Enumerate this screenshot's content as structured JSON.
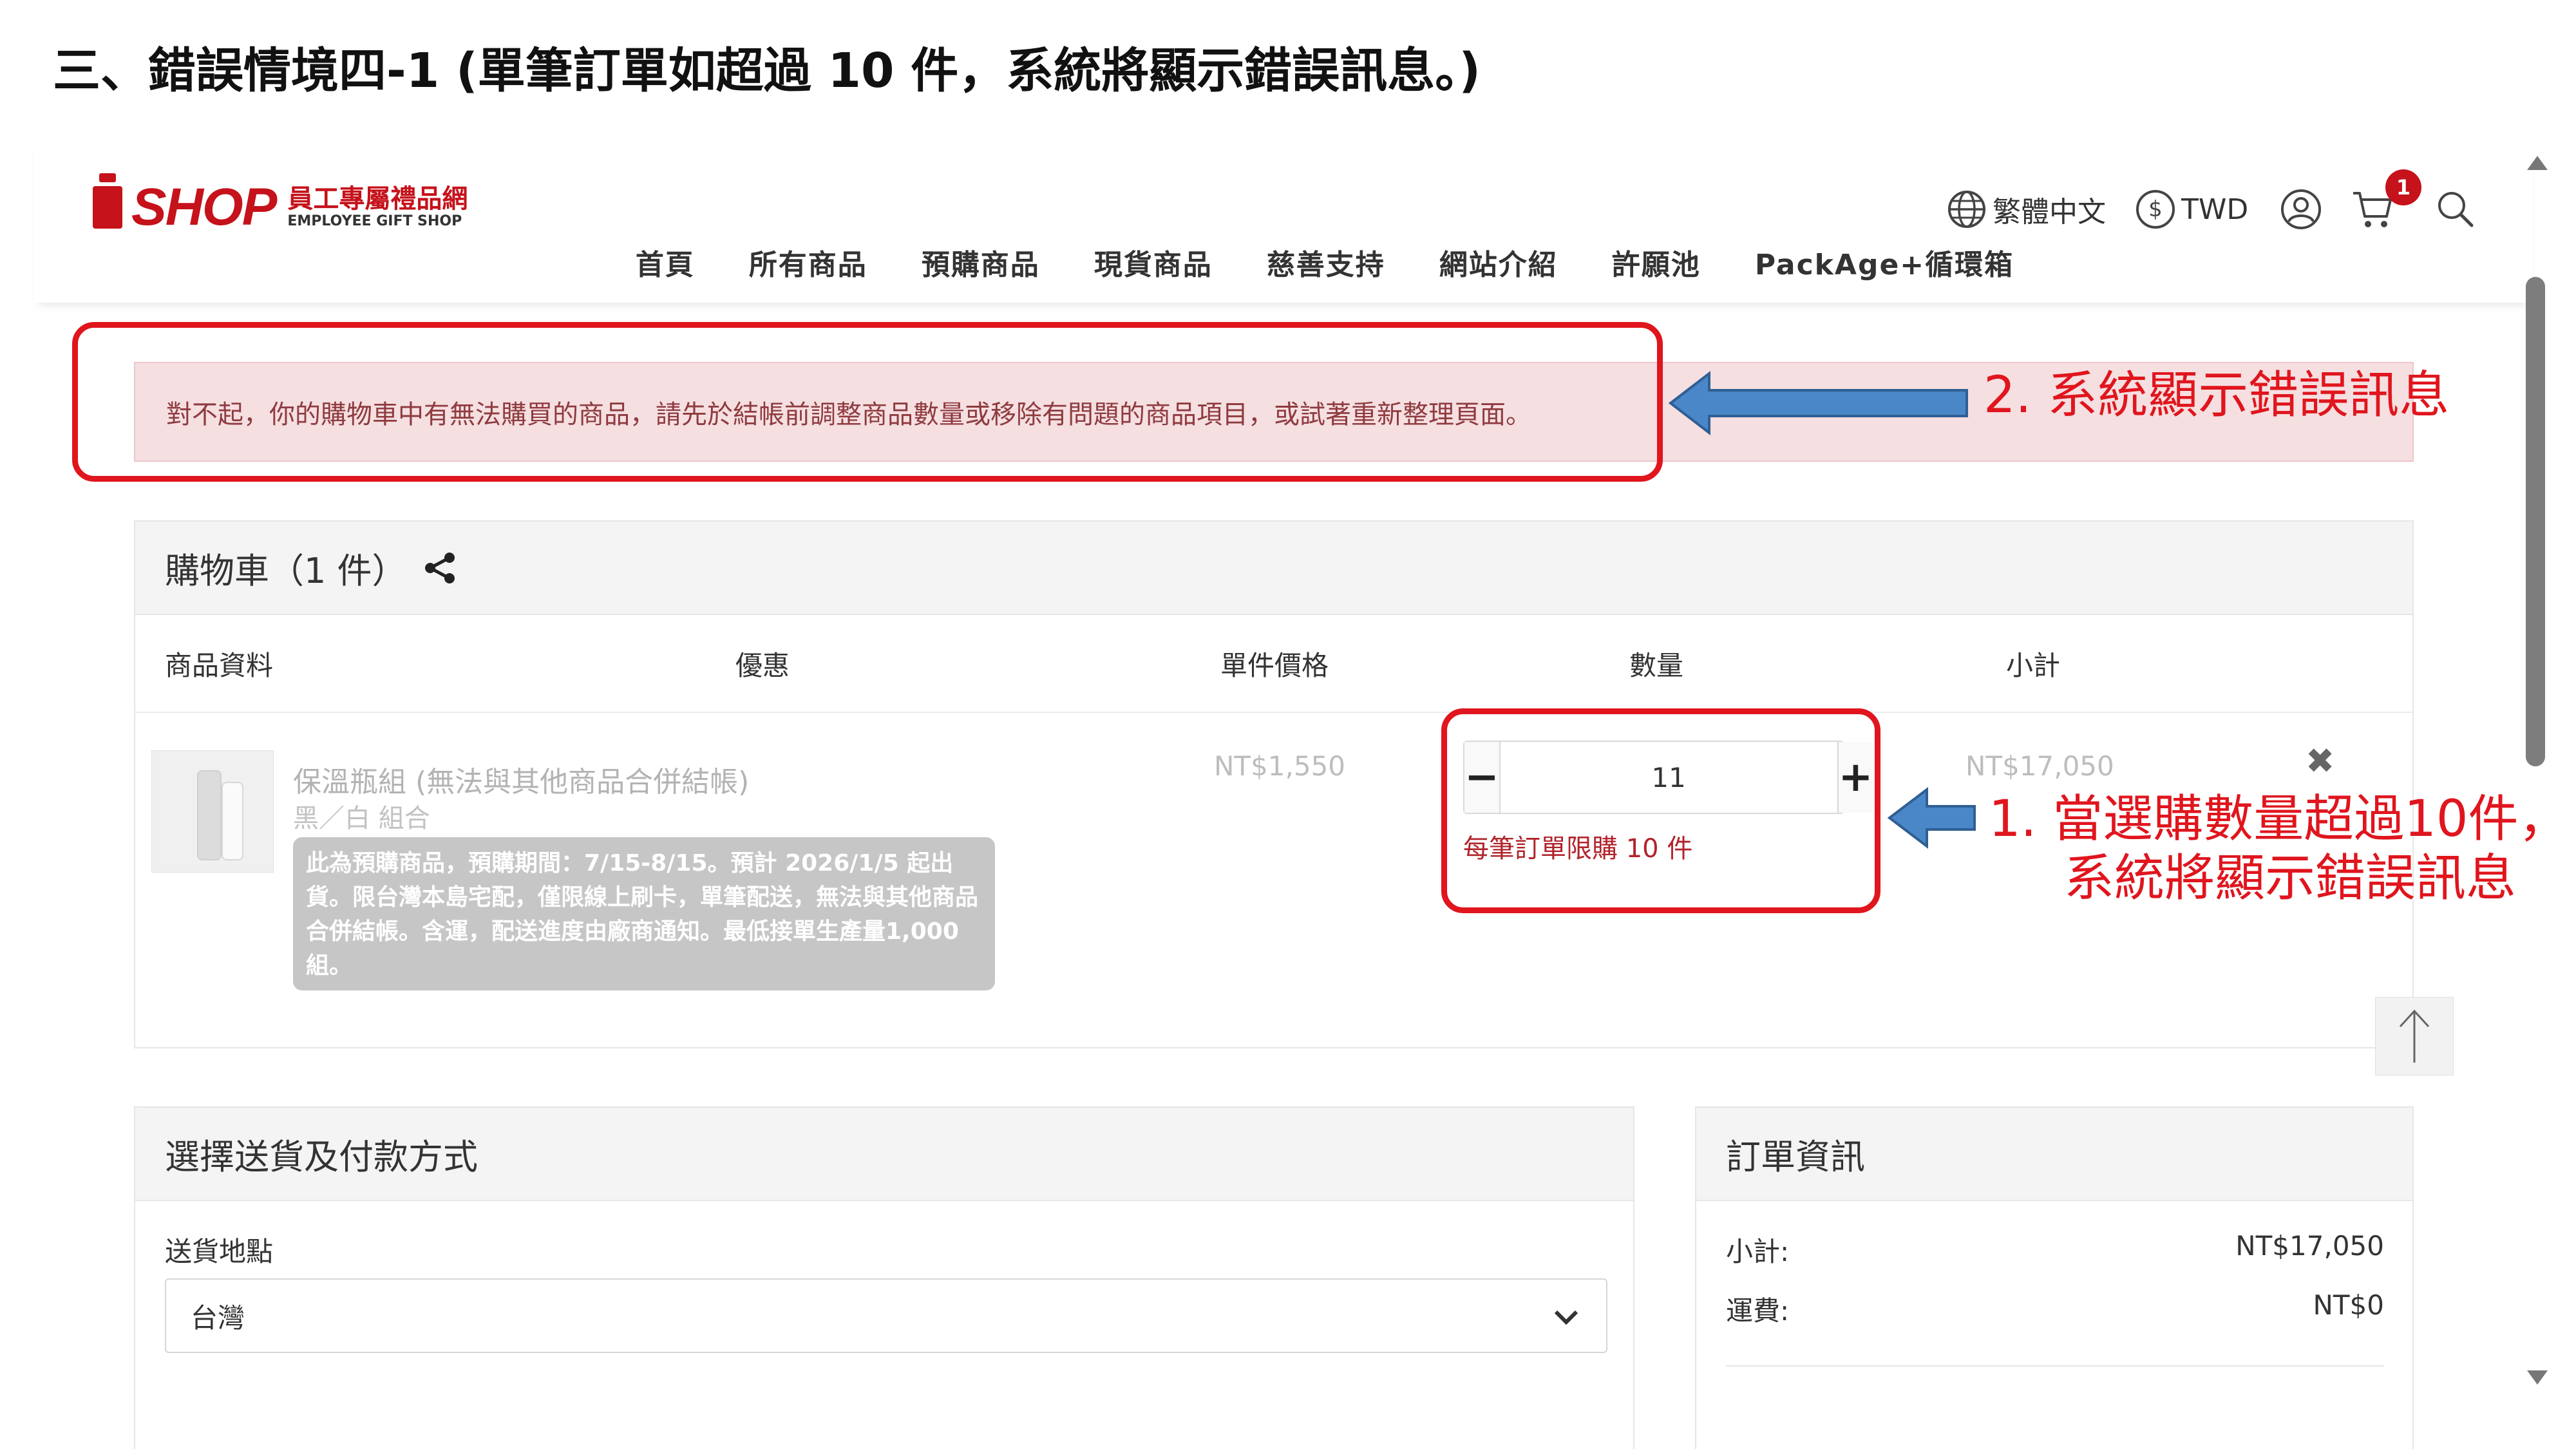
{
  "slide": {
    "title": "三、錯誤情境四-1 (單筆訂單如超過 10 件，系統將顯示錯誤訊息。)"
  },
  "header": {
    "logo_word": "SHOP",
    "logo_zh": "員工專屬禮品網",
    "logo_en": "EMPLOYEE GIFT SHOP",
    "language": "繁體中文",
    "currency": "TWD",
    "cart_count": "1",
    "icons": {
      "language": "globe-icon",
      "currency": "dollar-circle-icon",
      "account": "user-icon",
      "cart": "cart-icon",
      "search": "search-icon"
    },
    "nav": [
      "首頁",
      "所有商品",
      "預購商品",
      "現貨商品",
      "慈善支持",
      "網站介紹",
      "許願池",
      "PackAge+循環箱"
    ]
  },
  "alert": {
    "message": "對不起，你的購物車中有無法購買的商品，請先於結帳前調整商品數量或移除有問題的商品項目，或試著重新整理頁面。"
  },
  "annotations": {
    "a2": "2.  系統顯示錯誤訊息",
    "a1_line1": "1.  當選購數量超過10件，",
    "a1_line2": "系統將顯示錯誤訊息",
    "box_color": "#e0151d",
    "arrow_color": "#4a87c8"
  },
  "cart": {
    "title": "購物車（1 件）",
    "columns": {
      "product": "商品資料",
      "discount": "優惠",
      "unit_price": "單件價格",
      "quantity": "數量",
      "subtotal": "小計"
    },
    "item": {
      "name": "保溫瓶組 (無法與其他商品合併結帳)",
      "variant": "黑／白 組合",
      "note": "此為預購商品，預購期間：7/15-8/15。預計 2026/1/5 起出貨。限台灣本島宅配，僅限線上刷卡，單筆配送，無法與其他商品合併結帳。含運，配送進度由廠商通知。最低接單生產量1,000 組。",
      "unit_price": "NT$1,550",
      "quantity": "11",
      "qty_limit": "每筆訂單限購 10 件",
      "subtotal": "NT$17,050",
      "remove_icon": "close-icon",
      "minus": "−",
      "plus": "+"
    }
  },
  "delivery": {
    "title": "選擇送貨及付款方式",
    "location_label": "送貨地點",
    "location_value": "台灣"
  },
  "order": {
    "title": "訂單資訊",
    "subtotal_label": "小計:",
    "subtotal_value": "NT$17,050",
    "shipping_label": "運費:",
    "shipping_value": "NT$0"
  }
}
